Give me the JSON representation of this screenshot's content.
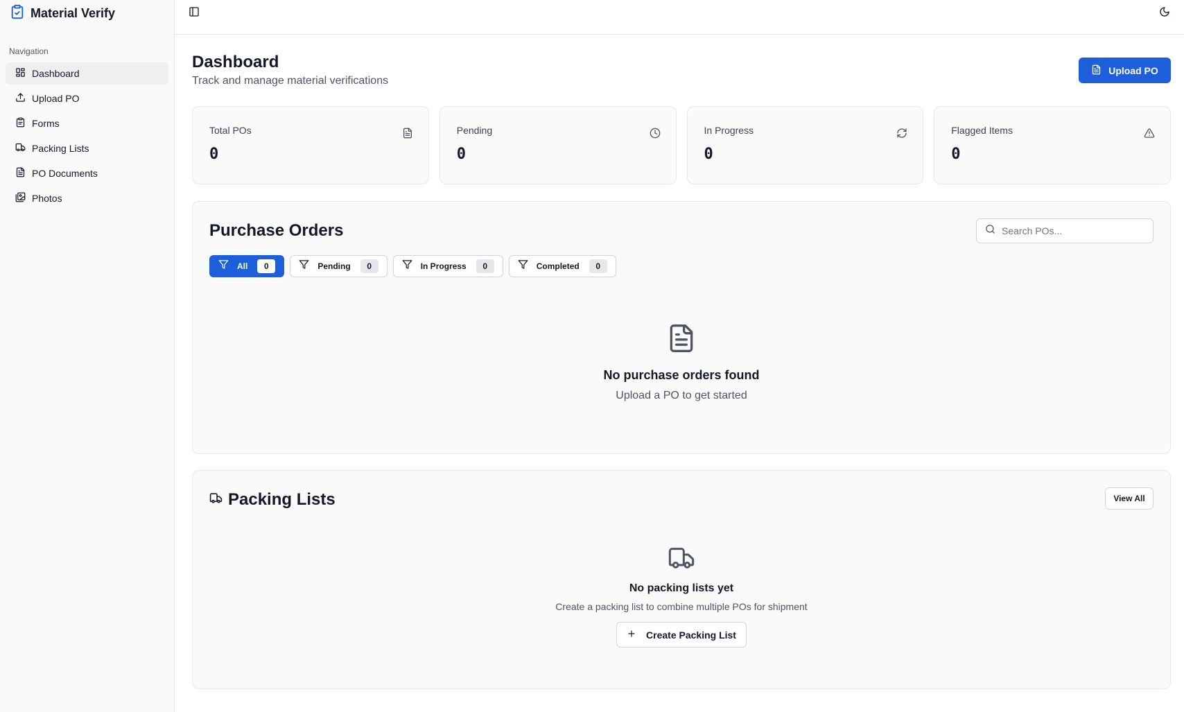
{
  "app": {
    "name": "Material Verify"
  },
  "sidebar": {
    "heading": "Navigation",
    "items": [
      {
        "label": "Dashboard",
        "icon": "dashboard-icon",
        "active": true
      },
      {
        "label": "Upload PO",
        "icon": "upload-icon"
      },
      {
        "label": "Forms",
        "icon": "clipboard-icon"
      },
      {
        "label": "Packing Lists",
        "icon": "truck-icon"
      },
      {
        "label": "PO Documents",
        "icon": "file-text-icon"
      },
      {
        "label": "Photos",
        "icon": "images-icon"
      }
    ]
  },
  "topbar": {
    "toggle_icon": "sidebar-toggle-icon",
    "theme_icon": "moon-icon"
  },
  "header": {
    "title": "Dashboard",
    "subtitle": "Track and manage material verifications",
    "upload_button": "Upload PO"
  },
  "stats": [
    {
      "label": "Total POs",
      "value": "0",
      "icon": "file-icon"
    },
    {
      "label": "Pending",
      "value": "0",
      "icon": "clock-icon"
    },
    {
      "label": "In Progress",
      "value": "0",
      "icon": "refresh-icon"
    },
    {
      "label": "Flagged Items",
      "value": "0",
      "icon": "warning-icon"
    }
  ],
  "purchase_orders": {
    "title": "Purchase Orders",
    "search_placeholder": "Search POs...",
    "filters": [
      {
        "label": "All",
        "count": "0",
        "active": true
      },
      {
        "label": "Pending",
        "count": "0"
      },
      {
        "label": "In Progress",
        "count": "0"
      },
      {
        "label": "Completed",
        "count": "0"
      }
    ],
    "empty_title": "No purchase orders found",
    "empty_subtitle": "Upload a PO to get started"
  },
  "packing_lists": {
    "title": "Packing Lists",
    "view_all": "View All",
    "empty_title": "No packing lists yet",
    "empty_subtitle": "Create a packing list to combine multiple POs for shipment",
    "create_button": "Create Packing List"
  },
  "colors": {
    "primary": "#1d5fdb",
    "sidebar_bg": "#fafafa",
    "card_bg": "#fafafa",
    "border": "#e5e7eb"
  }
}
